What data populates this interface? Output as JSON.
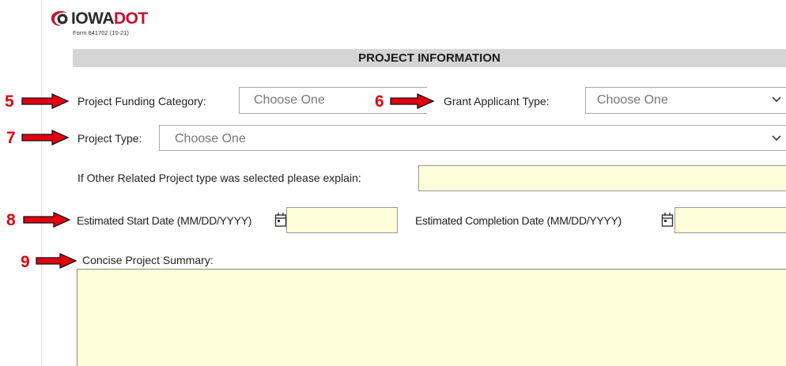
{
  "header": {
    "logo_text": "IOWA",
    "logo_text_accent": "DOT",
    "form_number": "Form 841702  (10-21)"
  },
  "section": {
    "title": "PROJECT INFORMATION"
  },
  "markers": [
    "5",
    "6",
    "7",
    "8",
    "9"
  ],
  "fields": {
    "funding_category": {
      "label": "Project Funding Category:",
      "value": "Choose One"
    },
    "applicant_type": {
      "label": "Grant Applicant Type:",
      "value": "Choose One"
    },
    "project_type": {
      "label": "Project Type:",
      "value": "Choose One"
    },
    "other_explain": {
      "label": "If Other Related Project type was selected please explain:",
      "value": ""
    },
    "start_date": {
      "label": "Estimated Start Date (MM/DD/YYYY)",
      "value": ""
    },
    "completion_date": {
      "label": "Estimated Completion Date (MM/DD/YYYY)",
      "value": ""
    },
    "summary": {
      "label": "Concise Project Summary:",
      "value": ""
    }
  },
  "colors": {
    "marker_red": "#e3000f",
    "field_yellow": "#fdfdd9",
    "header_gray": "#d5d5d5"
  },
  "icons": [
    "iowa-dot-logo-icon",
    "arrow-right-icon",
    "chevron-down-icon",
    "calendar-icon"
  ]
}
